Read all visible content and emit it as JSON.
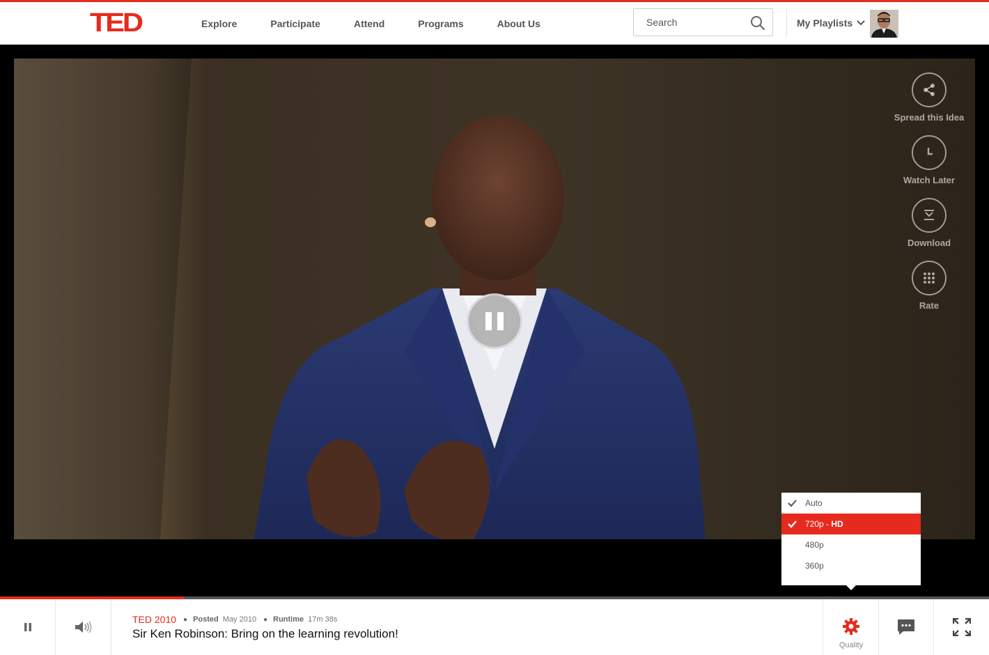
{
  "header": {
    "logo": "TED",
    "nav": [
      "Explore",
      "Participate",
      "Attend",
      "Programs",
      "About Us"
    ],
    "search_placeholder": "Search",
    "playlists_label": "My Playlists"
  },
  "video": {
    "side_actions": [
      {
        "label": "Spread this Idea",
        "icon": "share-icon"
      },
      {
        "label": "Watch Later",
        "icon": "clock-icon"
      },
      {
        "label": "Download",
        "icon": "download-icon"
      },
      {
        "label": "Rate",
        "icon": "dots-grid-icon"
      }
    ],
    "progress_fraction": 0.186
  },
  "quality_menu": {
    "options": [
      {
        "label": "Auto",
        "selected": false,
        "checked": true
      },
      {
        "label": "720p - ",
        "bold": "HD",
        "selected": true,
        "checked": true
      },
      {
        "label": "480p",
        "selected": false,
        "checked": false
      },
      {
        "label": "360p",
        "selected": false,
        "checked": false
      }
    ]
  },
  "player_bar": {
    "event": "TED 2010",
    "posted_label": "Posted",
    "posted_value": "May 2010",
    "runtime_label": "Runtime",
    "runtime_value": "17m 38s",
    "title": "Sir Ken Robinson: Bring on the learning revolution!",
    "quality_label": "Quality"
  },
  "colors": {
    "accent": "#e62b1e"
  }
}
